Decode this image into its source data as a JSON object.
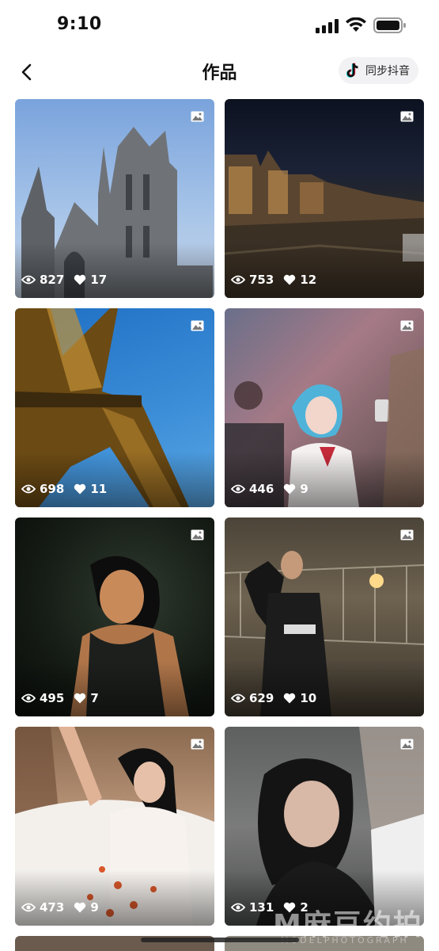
{
  "status_bar": {
    "time": "9:10"
  },
  "nav": {
    "title": "作品",
    "sync_label": "同步抖音"
  },
  "works": [
    {
      "views": "827",
      "likes": "17"
    },
    {
      "views": "753",
      "likes": "12"
    },
    {
      "views": "698",
      "likes": "11"
    },
    {
      "views": "446",
      "likes": "9"
    },
    {
      "views": "495",
      "likes": "7"
    },
    {
      "views": "629",
      "likes": "10"
    },
    {
      "views": "473",
      "likes": "9"
    },
    {
      "views": "131",
      "likes": "2"
    }
  ],
  "watermark": {
    "text": "M麻豆约拍",
    "subtext": "MODELPHOTOGRAPH"
  }
}
